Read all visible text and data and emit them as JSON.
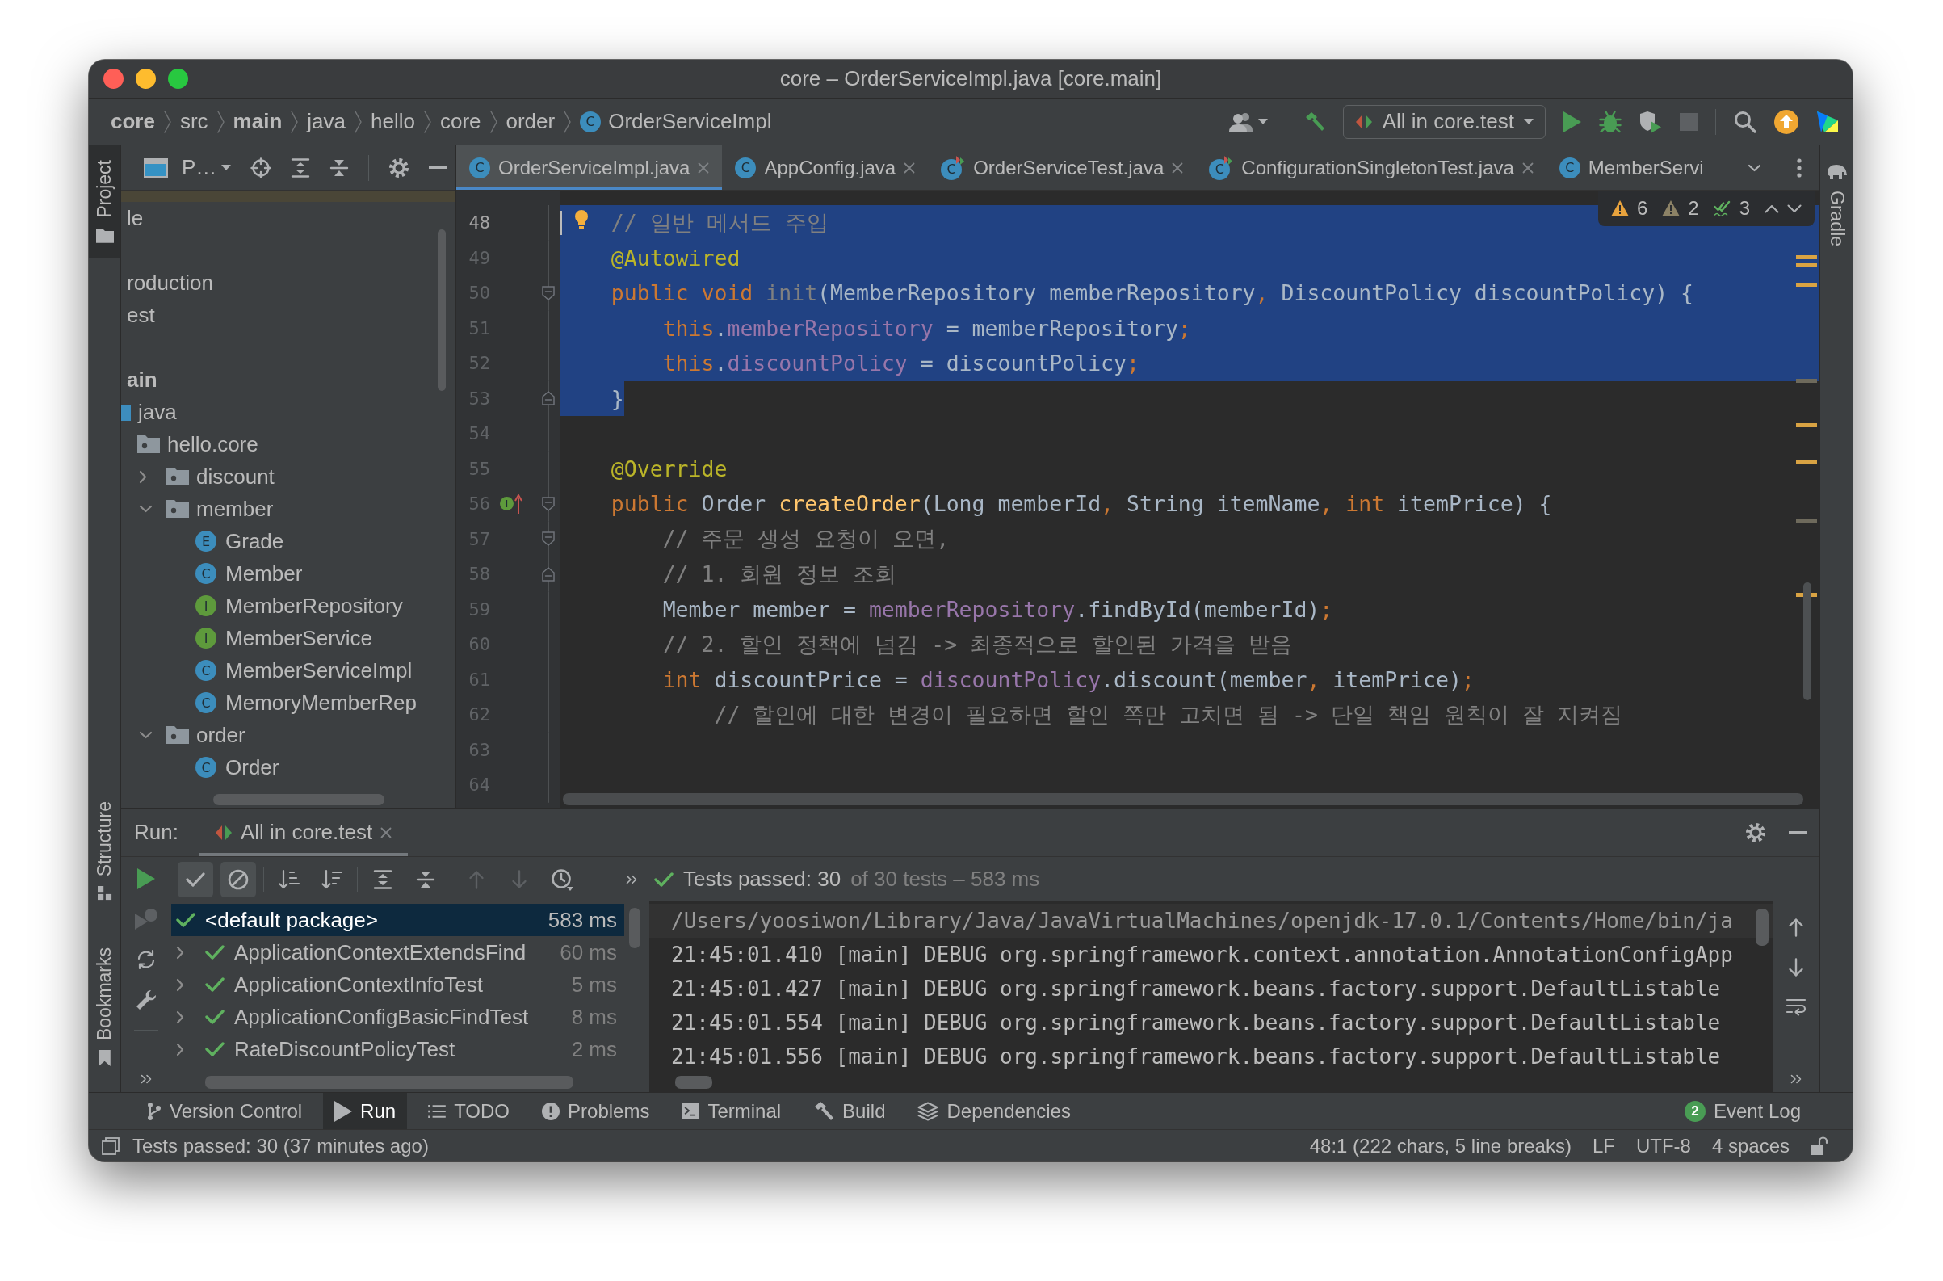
{
  "window": {
    "title": "core – OrderServiceImpl.java [core.main]"
  },
  "navigation": {
    "breadcrumbs": [
      {
        "label": "core",
        "kind": "module"
      },
      {
        "label": "src",
        "kind": "folder"
      },
      {
        "label": "main",
        "kind": "module"
      },
      {
        "label": "java",
        "kind": "folder"
      },
      {
        "label": "hello",
        "kind": "folder"
      },
      {
        "label": "core",
        "kind": "folder"
      },
      {
        "label": "order",
        "kind": "folder"
      },
      {
        "label": "OrderServiceImpl",
        "kind": "class",
        "icon_text": "C"
      }
    ],
    "run_configuration": "All in core.test",
    "actions": [
      {
        "kind": "run",
        "disabled": false
      },
      {
        "kind": "debug",
        "disabled": false
      },
      {
        "kind": "coverage",
        "disabled": false
      },
      {
        "kind": "stop",
        "disabled": true
      }
    ]
  },
  "left_tool_strip": [
    {
      "label": "Project",
      "kind": "project",
      "selected": true
    },
    {
      "label": "Structure",
      "kind": "structure",
      "selected": false
    },
    {
      "label": "Bookmarks",
      "kind": "bookmarks",
      "selected": false
    }
  ],
  "right_tool_strip": [
    {
      "label": "Gradle",
      "kind": "gradle",
      "selected": false
    }
  ],
  "project_panel": {
    "title": "P…",
    "tree": [
      {
        "kind": "blank",
        "color": "#4a4637"
      },
      {
        "kind": "item",
        "label": "le",
        "selected": false
      },
      {
        "kind": "blank"
      },
      {
        "kind": "item",
        "label": "roduction",
        "selected": false
      },
      {
        "kind": "item",
        "label": "est",
        "selected": false
      },
      {
        "kind": "blank"
      },
      {
        "kind": "item",
        "label": "ain",
        "bold": true,
        "selected": false,
        "children": [
          {
            "kind": "source_root",
            "label": "java",
            "selected": false,
            "children": [
              {
                "kind": "package",
                "label": "hello.core",
                "selected": false,
                "children": [
                  {
                    "kind": "package",
                    "label": "discount",
                    "expanded": false,
                    "selected": false
                  },
                  {
                    "kind": "package",
                    "label": "member",
                    "expanded": true,
                    "selected": false,
                    "children": [
                      {
                        "kind": "enum",
                        "label": "Grade",
                        "icon_text": "E",
                        "selected": false
                      },
                      {
                        "kind": "class",
                        "label": "Member",
                        "icon_text": "C",
                        "selected": false
                      },
                      {
                        "kind": "interface",
                        "label": "MemberRepository",
                        "icon_text": "I",
                        "selected": false
                      },
                      {
                        "kind": "interface",
                        "label": "MemberService",
                        "icon_text": "I",
                        "selected": false
                      },
                      {
                        "kind": "class",
                        "label": "MemberServiceImpl",
                        "icon_text": "C",
                        "selected": false
                      },
                      {
                        "kind": "class",
                        "label": "MemoryMemberRep",
                        "icon_text": "C",
                        "selected": false
                      }
                    ]
                  },
                  {
                    "kind": "package",
                    "label": "order",
                    "expanded": true,
                    "selected": false,
                    "children": [
                      {
                        "kind": "class",
                        "label": "Order",
                        "icon_text": "C",
                        "selected": false
                      }
                    ]
                  }
                ]
              }
            ]
          }
        ]
      }
    ]
  },
  "editor": {
    "tabs": [
      {
        "label": "OrderServiceImpl.java",
        "kind": "class",
        "icon_text": "C",
        "selected": true,
        "closable": true
      },
      {
        "label": "AppConfig.java",
        "kind": "class",
        "icon_text": "C",
        "selected": false,
        "closable": true
      },
      {
        "label": "OrderServiceTest.java",
        "kind": "test",
        "icon_text": "C",
        "selected": false,
        "closable": true
      },
      {
        "label": "ConfigurationSingletonTest.java",
        "kind": "test",
        "icon_text": "C",
        "selected": false,
        "closable": true
      },
      {
        "label": "MemberServi",
        "kind": "class",
        "icon_text": "C",
        "selected": false,
        "closable": false
      }
    ],
    "inspections": [
      {
        "kind": "warning",
        "count": "6"
      },
      {
        "kind": "weak_warning",
        "count": "2"
      },
      {
        "kind": "typo",
        "count": "3"
      }
    ],
    "lines": [
      {
        "number": "48",
        "selected": true,
        "caret": true,
        "marker": {
          "kind": "bulb"
        },
        "tokens": [
          {
            "kind": "comment",
            "text": "// 일반 메서드 주입"
          }
        ]
      },
      {
        "number": "49",
        "selected": true,
        "caret": false,
        "tokens": [
          {
            "kind": "annotation",
            "text": "@Autowired"
          }
        ]
      },
      {
        "number": "50",
        "selected": true,
        "caret": false,
        "fold": {
          "kind": "start"
        },
        "tokens": [
          {
            "kind": "keyword",
            "text": "public void "
          },
          {
            "kind": "unused",
            "text": "init"
          },
          {
            "kind": "plain",
            "text": "(MemberRepository memberRepository"
          },
          {
            "kind": "punct",
            "text": ","
          },
          {
            "kind": "plain",
            "text": " DiscountPolicy discountPolicy) {"
          }
        ],
        "children": [
          {
            "number": "51",
            "selected": true,
            "caret": false,
            "tokens": [
              {
                "kind": "keyword",
                "text": "this"
              },
              {
                "kind": "plain",
                "text": "."
              },
              {
                "kind": "field",
                "text": "memberRepository"
              },
              {
                "kind": "plain",
                "text": " = memberRepository"
              },
              {
                "kind": "punct",
                "text": ";"
              }
            ]
          },
          {
            "number": "52",
            "selected": true,
            "caret": false,
            "tokens": [
              {
                "kind": "keyword",
                "text": "this"
              },
              {
                "kind": "plain",
                "text": "."
              },
              {
                "kind": "field",
                "text": "discountPolicy"
              },
              {
                "kind": "plain",
                "text": " = discountPolicy"
              },
              {
                "kind": "punct",
                "text": ";"
              }
            ]
          }
        ]
      },
      {
        "number": "53",
        "selected": true,
        "caret": false,
        "fold": {
          "kind": "end"
        },
        "tokens": [
          {
            "kind": "plain",
            "text": "}"
          }
        ]
      },
      {
        "number": "54",
        "selected": false,
        "caret": false
      },
      {
        "number": "55",
        "selected": false,
        "caret": false,
        "tokens": [
          {
            "kind": "annotation",
            "text": "@Override"
          }
        ]
      },
      {
        "number": "56",
        "selected": false,
        "caret": false,
        "fold": {
          "kind": "start"
        },
        "marker": {
          "kind": "implements",
          "text": "I"
        },
        "tokens": [
          {
            "kind": "keyword",
            "text": "public"
          },
          {
            "kind": "plain",
            "text": " Order "
          },
          {
            "kind": "method",
            "text": "createOrder"
          },
          {
            "kind": "plain",
            "text": "(Long memberId"
          },
          {
            "kind": "punct",
            "text": ","
          },
          {
            "kind": "plain",
            "text": " String itemName"
          },
          {
            "kind": "punct",
            "text": ", "
          },
          {
            "kind": "keyword",
            "text": "int"
          },
          {
            "kind": "plain",
            "text": " itemPrice) {"
          }
        ],
        "children": [
          {
            "number": "57",
            "selected": false,
            "caret": false,
            "fold": {
              "kind": "start"
            },
            "tokens": [
              {
                "kind": "comment",
                "text": "// 주문 생성 요청이 오면,"
              }
            ]
          },
          {
            "number": "58",
            "selected": false,
            "caret": false,
            "fold": {
              "kind": "end"
            },
            "tokens": [
              {
                "kind": "comment",
                "text": "// 1. 회원 정보 조회"
              }
            ]
          },
          {
            "number": "59",
            "selected": false,
            "caret": false,
            "tokens": [
              {
                "kind": "plain",
                "text": "Member member = "
              },
              {
                "kind": "field",
                "text": "memberRepository"
              },
              {
                "kind": "plain",
                "text": ".findById(memberId)"
              },
              {
                "kind": "punct",
                "text": ";"
              }
            ]
          },
          {
            "number": "60",
            "selected": false,
            "caret": false,
            "tokens": [
              {
                "kind": "comment",
                "text": "// 2. 할인 정책에 넘김 -> 최종적으로 할인된 가격을 받음"
              }
            ]
          },
          {
            "number": "61",
            "selected": false,
            "caret": false,
            "tokens": [
              {
                "kind": "keyword",
                "text": "int"
              },
              {
                "kind": "plain",
                "text": " discountPrice = "
              },
              {
                "kind": "field",
                "text": "discountPolicy"
              },
              {
                "kind": "plain",
                "text": ".discount(member"
              },
              {
                "kind": "punct",
                "text": ","
              },
              {
                "kind": "plain",
                "text": " itemPrice)"
              },
              {
                "kind": "punct",
                "text": ";"
              }
            ],
            "children": [
              {
                "number": "62",
                "selected": false,
                "caret": false,
                "tokens": [
                  {
                    "kind": "comment",
                    "text": "// 할인에 대한 변경이 필요하면 할인 쪽만 고치면 됨 -> 단일 책임 원칙이 잘 지켜짐"
                  }
                ]
              }
            ]
          },
          {
            "number": "63",
            "selected": false,
            "caret": false
          },
          {
            "number": "64",
            "selected": false,
            "caret": false
          }
        ]
      }
    ]
  },
  "run_panel": {
    "label": "Run:",
    "tab": {
      "label": "All in core.test",
      "selected": true
    },
    "side_actions": [
      {
        "kind": "rerun",
        "disabled": false
      },
      {
        "kind": "rerun_failed",
        "disabled": true
      },
      {
        "kind": "auto_test",
        "disabled": false
      },
      {
        "kind": "settings",
        "disabled": false
      }
    ],
    "toolbar": [
      {
        "kind": "show_passed",
        "on": true,
        "disabled": false
      },
      {
        "kind": "show_ignored",
        "on": true,
        "disabled": false
      },
      {
        "kind": "sort_alpha",
        "on": false,
        "disabled": false
      },
      {
        "kind": "sort_duration",
        "on": false,
        "disabled": false
      },
      {
        "kind": "expand_all",
        "on": false,
        "disabled": false
      },
      {
        "kind": "collapse_all",
        "on": false,
        "disabled": false
      },
      {
        "kind": "previous",
        "on": false,
        "disabled": true
      },
      {
        "kind": "next",
        "on": false,
        "disabled": true
      },
      {
        "kind": "history",
        "on": false,
        "disabled": false
      }
    ],
    "summary": {
      "passed": true,
      "headline": "Tests passed: 30",
      "detail": "of 30 tests – 583 ms"
    },
    "tests": [
      {
        "label": "<default package>",
        "duration": "583 ms",
        "passed": true,
        "selected": true,
        "children": [
          {
            "label": "ApplicationContextExtendsFind",
            "duration": "60 ms",
            "passed": true,
            "expanded": false,
            "selected": false
          },
          {
            "label": "ApplicationContextInfoTest",
            "duration": "5 ms",
            "passed": true,
            "expanded": false,
            "selected": false
          },
          {
            "label": "ApplicationConfigBasicFindTest",
            "duration": "8 ms",
            "passed": true,
            "expanded": false,
            "selected": false
          },
          {
            "label": "RateDiscountPolicyTest",
            "duration": "2 ms",
            "passed": true,
            "expanded": false,
            "selected": false
          }
        ]
      }
    ],
    "console": [
      {
        "kind": "command",
        "text": "/Users/yoosiwon/Library/Java/JavaVirtualMachines/openjdk-17.0.1/Contents/Home/bin/ja"
      },
      {
        "kind": "log",
        "text": "21:45:01.410 [main] DEBUG org.springframework.context.annotation.AnnotationConfigApp"
      },
      {
        "kind": "log",
        "text": "21:45:01.427 [main] DEBUG org.springframework.beans.factory.support.DefaultListable"
      },
      {
        "kind": "log",
        "text": "21:45:01.554 [main] DEBUG org.springframework.beans.factory.support.DefaultListable"
      },
      {
        "kind": "log",
        "text": "21:45:01.556 [main] DEBUG org.springframework.beans.factory.support.DefaultListable"
      }
    ]
  },
  "tool_windows": [
    {
      "label": "Version Control",
      "kind": "vcs",
      "selected": false
    },
    {
      "label": "Run",
      "kind": "run",
      "selected": true
    },
    {
      "label": "TODO",
      "kind": "todo",
      "selected": false
    },
    {
      "label": "Problems",
      "kind": "problems",
      "selected": false
    },
    {
      "label": "Terminal",
      "kind": "terminal",
      "selected": false
    },
    {
      "label": "Build",
      "kind": "build",
      "selected": false
    },
    {
      "label": "Dependencies",
      "kind": "dependencies",
      "selected": false
    }
  ],
  "event_log": {
    "label": "Event Log",
    "badge": "2",
    "selected": false
  },
  "status_bar": {
    "message": "Tests passed: 30 (37 minutes ago)",
    "position": "48:1 (222 chars, 5 line breaks)",
    "line_separator": "LF",
    "encoding": "UTF-8",
    "indent": "4 spaces",
    "read_only": false
  }
}
